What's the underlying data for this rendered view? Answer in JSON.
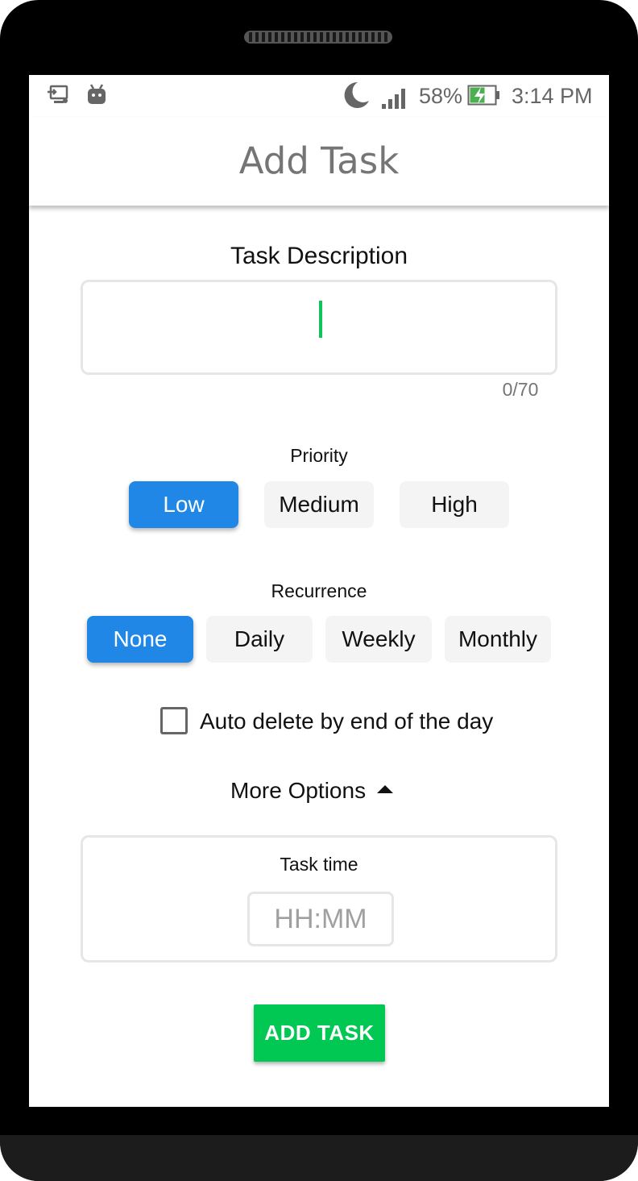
{
  "status_bar": {
    "battery_percent": "58%",
    "time": "3:14 PM",
    "icons": [
      "screen-cast-icon",
      "android-debug-icon",
      "moon-icon",
      "signal-icon",
      "battery-charging-icon"
    ]
  },
  "app_bar": {
    "title": "Add Task"
  },
  "task_description": {
    "label": "Task Description",
    "value": "",
    "counter": "0/70"
  },
  "priority": {
    "label": "Priority",
    "options": [
      "Low",
      "Medium",
      "High"
    ],
    "selected": "Low"
  },
  "recurrence": {
    "label": "Recurrence",
    "options": [
      "None",
      "Daily",
      "Weekly",
      "Monthly"
    ],
    "selected": "None"
  },
  "auto_delete": {
    "label": "Auto delete by end of the day",
    "checked": false
  },
  "more_options": {
    "label": "More Options"
  },
  "task_time": {
    "label": "Task time",
    "placeholder": "HH:MM",
    "value": ""
  },
  "add_button": {
    "label": "ADD TASK"
  },
  "colors": {
    "accent_blue": "#2187e6",
    "add_green": "#00c853",
    "cursor_green": "#10c45c",
    "chip_gray": "#f4f4f4"
  }
}
